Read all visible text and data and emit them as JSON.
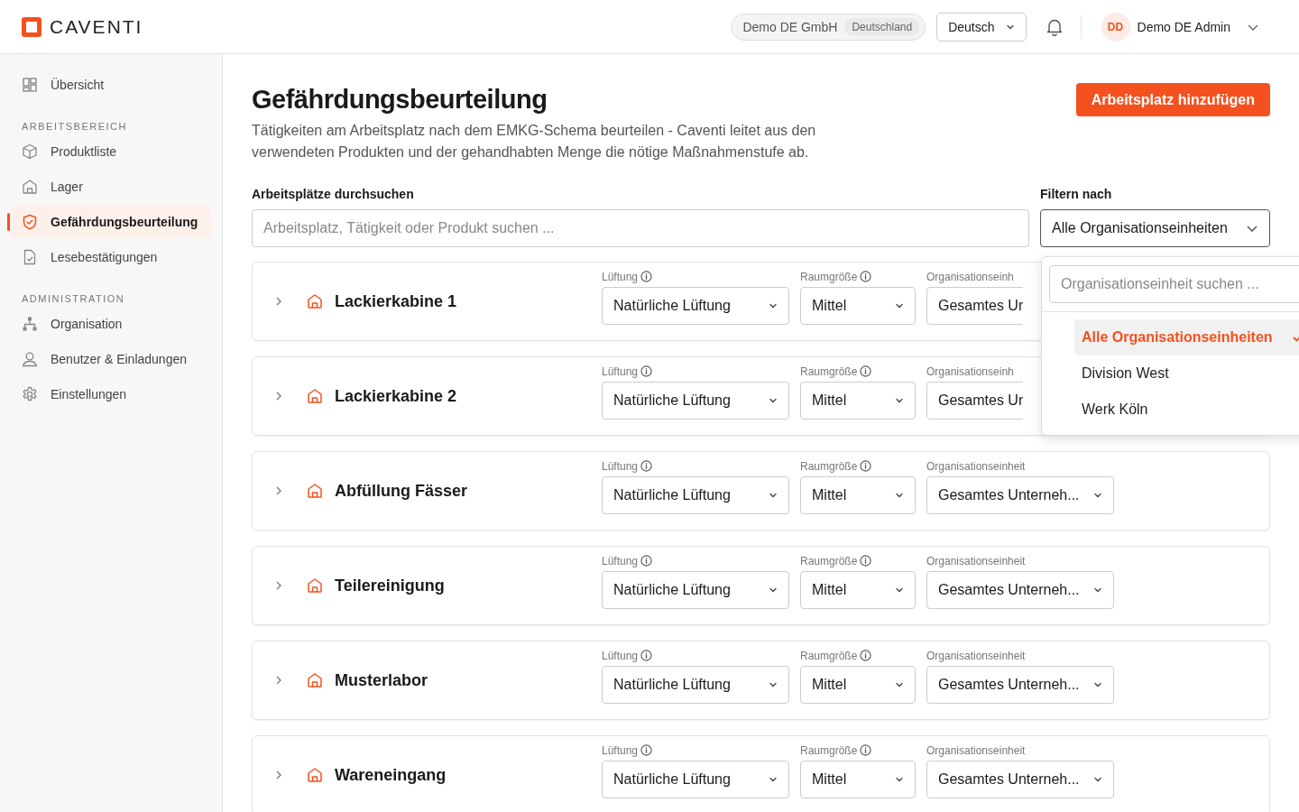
{
  "header": {
    "logo": "CAVENTI",
    "company": "Demo DE GmbH",
    "country": "Deutschland",
    "language": "Deutsch",
    "user_initials": "DD",
    "user_name": "Demo DE Admin"
  },
  "sidebar": {
    "sections": [
      {
        "items": [
          {
            "label": "Übersicht",
            "kind": "dashboard",
            "selected": false
          }
        ]
      },
      {
        "title": "ARBEITSBEREICH",
        "items": [
          {
            "label": "Produktliste",
            "kind": "box",
            "selected": false
          },
          {
            "label": "Lager",
            "kind": "warehouse",
            "selected": false
          },
          {
            "label": "Gefährdungsbeurteilung",
            "kind": "shield",
            "selected": true
          },
          {
            "label": "Lesebestätigungen",
            "kind": "doc",
            "selected": false
          }
        ]
      },
      {
        "title": "ADMINISTRATION",
        "items": [
          {
            "label": "Organisation",
            "kind": "org",
            "selected": false
          },
          {
            "label": "Benutzer & Einladungen",
            "kind": "user",
            "selected": false
          },
          {
            "label": "Einstellungen",
            "kind": "gear",
            "selected": false
          }
        ]
      }
    ]
  },
  "page": {
    "title": "Gefährdungsbeurteilung",
    "description": "Tätigkeiten am Arbeitsplatz nach dem EMKG-Schema beurteilen - Caventi leitet aus den verwendeten Produkten und der gehandhabten Menge die nötige Maßnahmenstufe ab.",
    "add_button": "Arbeitsplatz hinzufügen"
  },
  "search": {
    "label": "Arbeitsplätze durchsuchen",
    "placeholder": "Arbeitsplatz, Tätigkeit oder Produkt suchen ..."
  },
  "filter": {
    "label": "Filtern nach",
    "value": "Alle Organisationseinheiten",
    "expanded": true,
    "menu": {
      "placeholder": "Organisationseinheit suchen ...",
      "options": [
        {
          "label": "Alle Organisationseinheiten",
          "selected": true
        },
        {
          "label": "Division West",
          "selected": false
        },
        {
          "label": "Werk Köln",
          "selected": false
        }
      ]
    }
  },
  "workplaces": [
    {
      "name": "Lackierkabine 1",
      "ventilation_label": "Lüftung",
      "ventilation": "Natürliche Lüftung",
      "room_label": "Raumgröße",
      "room": "Mittel",
      "org_label": "Organisationseinh",
      "org": "Gesamtes Ur",
      "org_cut": true
    },
    {
      "name": "Lackierkabine 2",
      "ventilation_label": "Lüftung",
      "ventilation": "Natürliche Lüftung",
      "room_label": "Raumgröße",
      "room": "Mittel",
      "org_label": "Organisationseinh",
      "org": "Gesamtes Ur",
      "org_cut": true
    },
    {
      "name": "Abfüllung Fässer",
      "ventilation_label": "Lüftung",
      "ventilation": "Natürliche Lüftung",
      "room_label": "Raumgröße",
      "room": "Mittel",
      "org_label": "Organisationseinheit",
      "org": "Gesamtes Unterneh...",
      "org_cut": false
    },
    {
      "name": "Teilereinigung",
      "ventilation_label": "Lüftung",
      "ventilation": "Natürliche Lüftung",
      "room_label": "Raumgröße",
      "room": "Mittel",
      "org_label": "Organisationseinheit",
      "org": "Gesamtes Unterneh...",
      "org_cut": false
    },
    {
      "name": "Musterlabor",
      "ventilation_label": "Lüftung",
      "ventilation": "Natürliche Lüftung",
      "room_label": "Raumgröße",
      "room": "Mittel",
      "org_label": "Organisationseinheit",
      "org": "Gesamtes Unterneh...",
      "org_cut": false
    },
    {
      "name": "Wareneingang",
      "ventilation_label": "Lüftung",
      "ventilation": "Natürliche Lüftung",
      "room_label": "Raumgröße",
      "room": "Mittel",
      "org_label": "Organisationseinheit",
      "org": "Gesamtes Unterneh...",
      "org_cut": false
    }
  ]
}
